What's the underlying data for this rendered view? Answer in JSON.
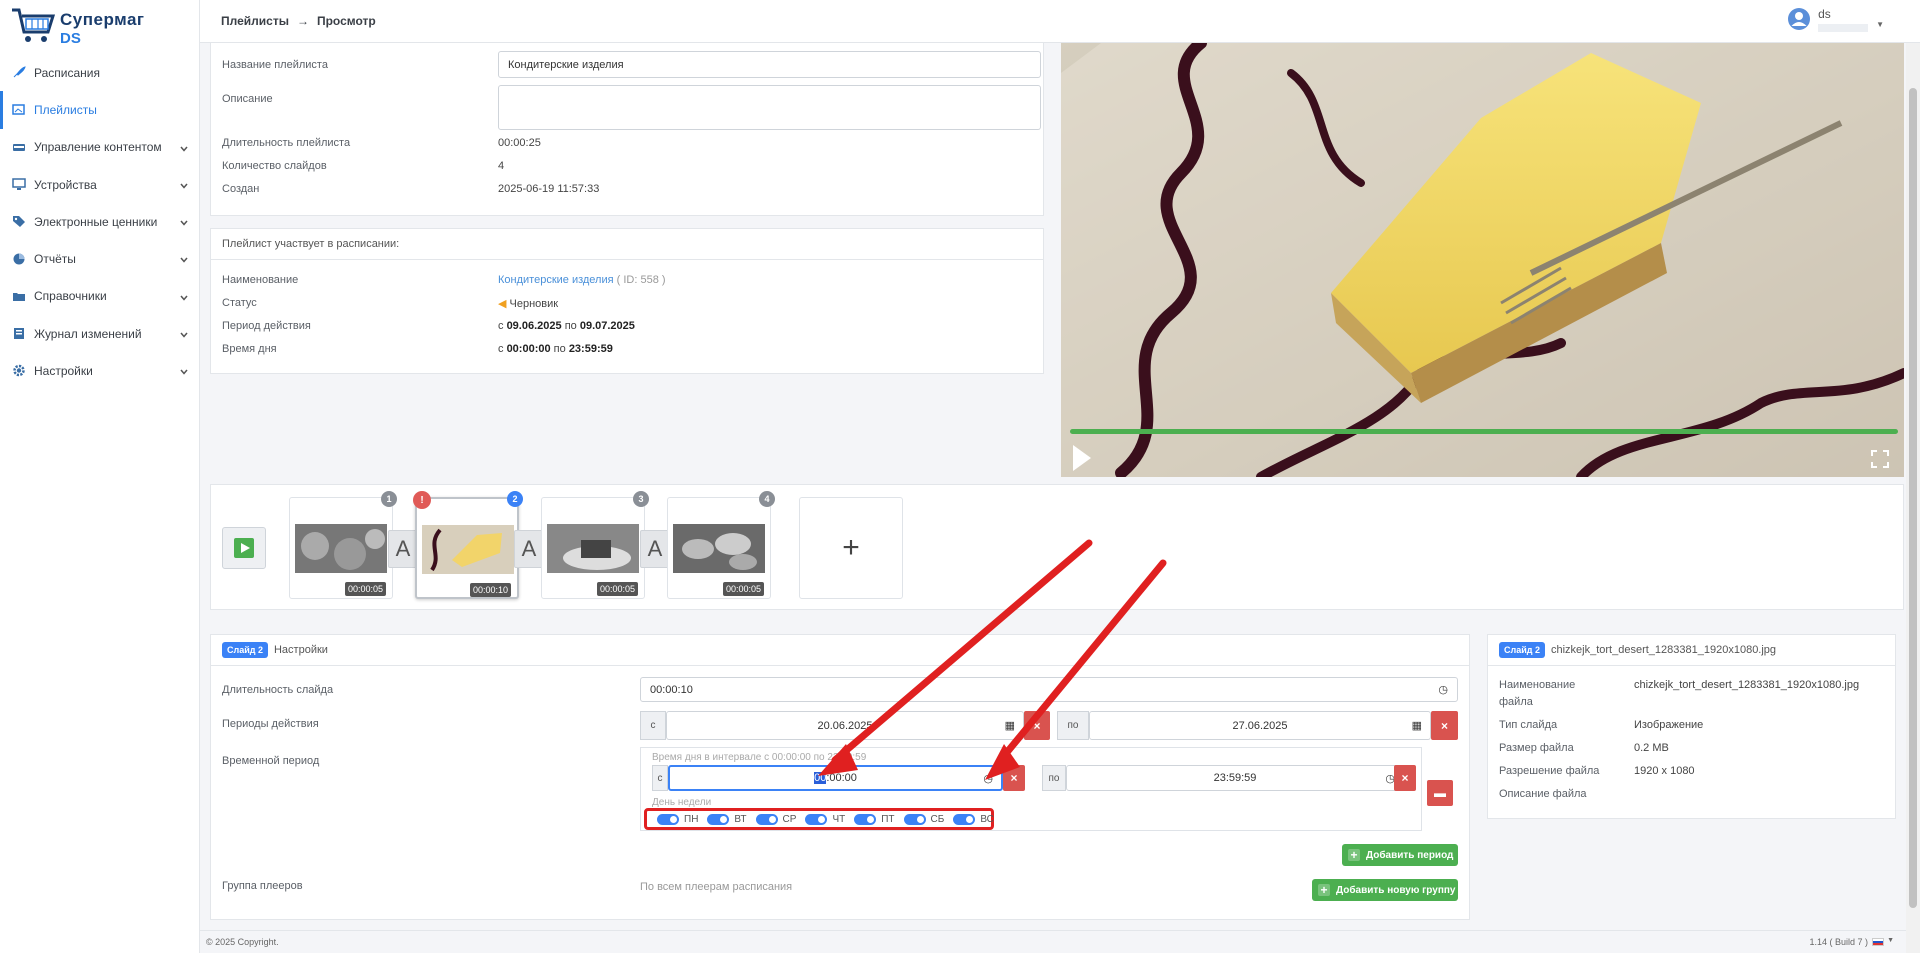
{
  "brand": {
    "line1": "Супермаг",
    "line2": "DS"
  },
  "sidebar": {
    "items": [
      {
        "label": "Расписания",
        "icon": "rocket-icon",
        "expand": false,
        "active": false
      },
      {
        "label": "Плейлисты",
        "icon": "images-icon",
        "expand": false,
        "active": true
      },
      {
        "label": "Управление контентом",
        "icon": "layers-icon",
        "expand": true,
        "active": false
      },
      {
        "label": "Устройства",
        "icon": "monitor-icon",
        "expand": true,
        "active": false
      },
      {
        "label": "Электронные ценники",
        "icon": "tags-icon",
        "expand": true,
        "active": false
      },
      {
        "label": "Отчёты",
        "icon": "pie-chart-icon",
        "expand": true,
        "active": false
      },
      {
        "label": "Справочники",
        "icon": "folder-icon",
        "expand": true,
        "active": false
      },
      {
        "label": "Журнал изменений",
        "icon": "journal-icon",
        "expand": true,
        "active": false
      },
      {
        "label": "Настройки",
        "icon": "gear-icon",
        "expand": true,
        "active": false
      }
    ]
  },
  "header": {
    "crumb1": "Плейлисты",
    "crumb2": "Просмотр",
    "user": "ds"
  },
  "playlist": {
    "name_label": "Название плейлиста",
    "name_value": "Кондитерские изделия",
    "desc_label": "Описание",
    "desc_value": "",
    "dur_label": "Длительность плейлиста",
    "dur_value": "00:00:25",
    "count_label": "Количество слайдов",
    "count_value": "4",
    "created_label": "Создан",
    "created_value": "2025-06-19 11:57:33"
  },
  "schedule": {
    "title": "Плейлист участвует в расписании:",
    "name_label": "Наименование",
    "name_link": "Кондитерские изделия",
    "name_id": "( ID: 558 )",
    "status_label": "Статус",
    "status_value": "Черновик",
    "period_label": "Период действия",
    "period_from_word": "с",
    "period_from": "09.06.2025",
    "period_to_word": "по",
    "period_to": "09.07.2025",
    "time_label": "Время дня",
    "time_from_word": "с",
    "time_from": "00:00:00",
    "time_to_word": "по",
    "time_to": "23:59:59"
  },
  "slides": [
    {
      "num": "1",
      "dur": "00:00:05",
      "color": "#8a8f96"
    },
    {
      "num": "2",
      "dur": "00:00:10",
      "color": "#3b82f6"
    },
    {
      "num": "3",
      "dur": "00:00:05",
      "color": "#8a8f96"
    },
    {
      "num": "4",
      "dur": "00:00:05",
      "color": "#8a8f96"
    }
  ],
  "transition_label": "A",
  "add_slide": "+",
  "slide_settings": {
    "badge": "Слайд 2",
    "title": "Настройки",
    "dur_label": "Длительность слайда",
    "dur_value": "00:00:10",
    "periods_label": "Периоды действия",
    "from_word": "с",
    "from_date": "20.06.2025",
    "to_word": "по",
    "to_date": "27.06.2025",
    "time_label": "Временной период",
    "interval_hint": "Время дня в интервале с 00:00:00 по 23:59:59",
    "time_from_word": "с",
    "time_from_sel": "00",
    "time_from_rest": ":00:00",
    "time_to_word": "по",
    "time_to": "23:59:59",
    "weekday_label": "День недели",
    "days": [
      "ПН",
      "ВТ",
      "СР",
      "ЧТ",
      "ПТ",
      "СБ",
      "ВС"
    ],
    "add_period": "Добавить период",
    "group_label": "Группа плееров",
    "group_value": "По всем плеерам расписания",
    "add_group": "Добавить новую группу"
  },
  "file_info": {
    "badge": "Слайд 2",
    "filename": "chizkejk_tort_desert_1283381_1920x1080.jpg",
    "name_label": "Наименование",
    "name_label2": "файла",
    "name_value": "chizkejk_tort_desert_1283381_1920x1080.jpg",
    "type_label": "Тип слайда",
    "type_value": "Изображение",
    "size_label": "Размер файла",
    "size_value": "0.2 MB",
    "res_label": "Разрешение файла",
    "res_value": "1920 x 1080",
    "desc_label": "Описание файла"
  },
  "footer": {
    "copyright": "© 2025 Copyright.",
    "version": "1.14 ( Build 7 )"
  },
  "colors": {
    "accent": "#2a7de1",
    "success": "#4caf50",
    "danger": "#d9534f",
    "highlight": "#e02020"
  }
}
